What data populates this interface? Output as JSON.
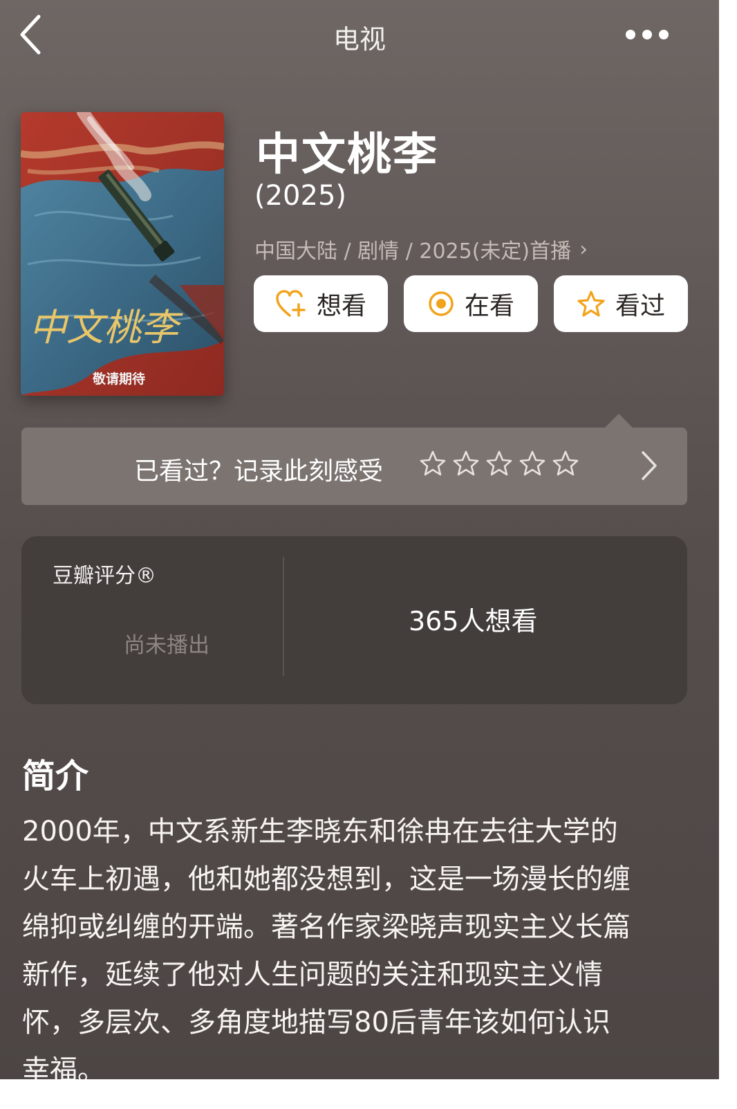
{
  "nav": {
    "title": "电视",
    "back_icon": "chevron-left-icon",
    "more_icon": "more-horizontal-icon"
  },
  "poster": {
    "calligraphy": "中文桃李",
    "tagline": "敬请期待",
    "colors": {
      "red": "#a8352a",
      "blue": "#3f6e8a",
      "gold": "#e8c66a"
    }
  },
  "title": "中文桃李",
  "year": "(2025)",
  "meta": "中国大陆 / 剧情 / 2025(未定)首播",
  "actions": {
    "want": {
      "label": "想看",
      "icon": "heart-plus-icon"
    },
    "doing": {
      "label": "在看",
      "icon": "target-circle-icon"
    },
    "done": {
      "label": "看过",
      "icon": "star-outline-icon"
    },
    "accent": "#f2a31b"
  },
  "rating_prompt": {
    "text": "已看过？记录此刻感受",
    "stars": 5
  },
  "score": {
    "label": "豆瓣评分®",
    "status": "尚未播出",
    "want_count": "365人想看"
  },
  "synopsis": {
    "title": "简介",
    "lines": [
      "2000年，中文系新生李晓东和徐冉在去往大学的",
      "火车上初遇，他和她都没想到，这是一场漫长的缠",
      "绵抑或纠缠的开端。著名作家梁晓声现实主义长篇",
      "新作，延续了他对人生问题的关注和现实主义情",
      "怀，多层次、多角度地描写80后青年该如何认识",
      "幸福。"
    ]
  }
}
